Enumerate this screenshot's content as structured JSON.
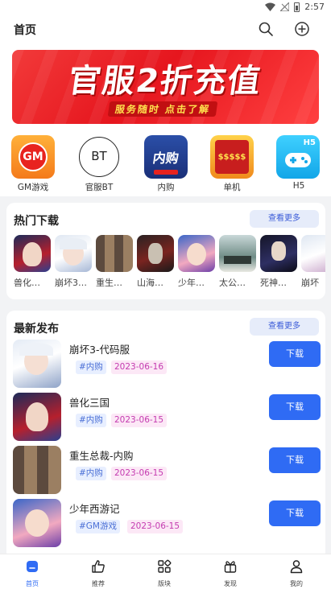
{
  "status": {
    "time": "2:57"
  },
  "header": {
    "title": "首页",
    "search_icon": "search-icon",
    "add_icon": "plus-circle-icon"
  },
  "banner": {
    "headline": "官服2折充值",
    "subline": "服务随时  点击了解"
  },
  "categories": [
    {
      "label": "GM游戏",
      "icon_text": "GM"
    },
    {
      "label": "官服BT",
      "icon_text": "BT"
    },
    {
      "label": "内购",
      "icon_text": "内购"
    },
    {
      "label": "单机",
      "icon_text": "$$$$$"
    },
    {
      "label": "H5",
      "icon_text": "H5"
    }
  ],
  "hot": {
    "title": "热门下载",
    "more": "查看更多",
    "items": [
      {
        "name": "兽化…"
      },
      {
        "name": "崩坏3…"
      },
      {
        "name": "重生…"
      },
      {
        "name": "山海…"
      },
      {
        "name": "少年…"
      },
      {
        "name": "太公…"
      },
      {
        "name": "死神…"
      },
      {
        "name": "崩坏"
      }
    ]
  },
  "latest": {
    "title": "最新发布",
    "more": "查看更多",
    "items": [
      {
        "name": "崩坏3-代码服",
        "tag": "#内购",
        "date": "2023-06-16",
        "button": "下载"
      },
      {
        "name": "兽化三国",
        "tag": "#内购",
        "date": "2023-06-15",
        "button": "下载"
      },
      {
        "name": "重生总裁-内购",
        "tag": "#内购",
        "date": "2023-06-15",
        "button": "下载"
      },
      {
        "name": "少年西游记",
        "tag": "#GM游戏",
        "date": "2023-06-15",
        "button": "下载"
      }
    ]
  },
  "nav": [
    {
      "label": "首页",
      "icon": "home-icon"
    },
    {
      "label": "推荐",
      "icon": "thumbs-up-icon"
    },
    {
      "label": "版块",
      "icon": "grid-icon"
    },
    {
      "label": "发现",
      "icon": "gift-icon"
    },
    {
      "label": "我的",
      "icon": "user-icon"
    }
  ],
  "colors": {
    "accent": "#2f6bf4",
    "banner_red": "#e6161e",
    "tag_blue": "#4a6fd6",
    "tag_pink": "#c43bb0"
  }
}
